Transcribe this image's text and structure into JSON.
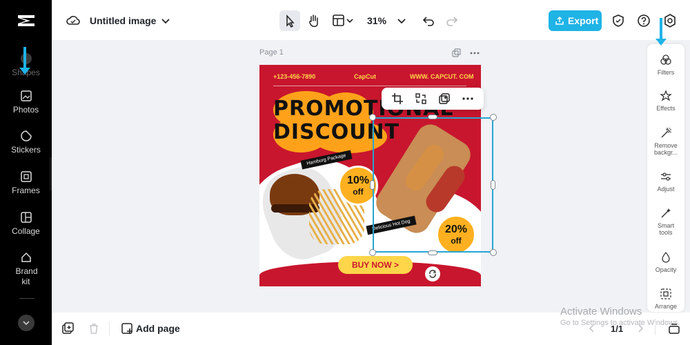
{
  "colors": {
    "accent": "#1fb3e6",
    "sidebar_bg": "#000000",
    "canvas_bg": "#f1f2f5",
    "poster_red": "#c8162e",
    "poster_yellow": "#ffd54a",
    "poster_orange": "#ffa21a",
    "selection": "#25a5d3"
  },
  "sidebar": {
    "items": [
      {
        "label": "Shapes",
        "icon": "shapes-icon"
      },
      {
        "label": "Photos",
        "icon": "photo-icon"
      },
      {
        "label": "Stickers",
        "icon": "sticker-icon"
      },
      {
        "label": "Frames",
        "icon": "frame-icon"
      },
      {
        "label": "Collage",
        "icon": "collage-icon"
      },
      {
        "label": "Brand kit",
        "icon": "brand-kit-icon"
      }
    ]
  },
  "header": {
    "title": "Untitled image",
    "zoom": "31%",
    "export_label": "Export"
  },
  "canvas": {
    "page_label": "Page 1",
    "poster": {
      "phone": "+123-456-7890",
      "brand": "CapCut",
      "website": "WWW. CAPCUT. COM",
      "headline_1": "PROMOTIONAL",
      "headline_2": "DISCOUNT",
      "tag_1": "Hamburg Package",
      "tag_2": "Delicious Hot Dog",
      "badge_1_pct": "10%",
      "badge_1_off": "off",
      "badge_2_pct": "20%",
      "badge_2_off": "off",
      "cta": "BUY NOW >"
    }
  },
  "right_panel": {
    "items": [
      {
        "label": "Filters",
        "icon": "filters-icon"
      },
      {
        "label": "Effects",
        "icon": "effects-icon"
      },
      {
        "label": "Remove backgr...",
        "icon": "remove-background-icon"
      },
      {
        "label": "Adjust",
        "icon": "adjust-icon"
      },
      {
        "label": "Smart tools",
        "icon": "smart-tools-icon"
      },
      {
        "label": "Opacity",
        "icon": "opacity-icon"
      },
      {
        "label": "Arrange",
        "icon": "arrange-icon"
      }
    ]
  },
  "bottom": {
    "add_page_label": "Add page",
    "page_count": "1/1"
  },
  "windows_watermark": {
    "line1": "Activate Windows",
    "line2": "Go to Settings to activate Windows."
  }
}
